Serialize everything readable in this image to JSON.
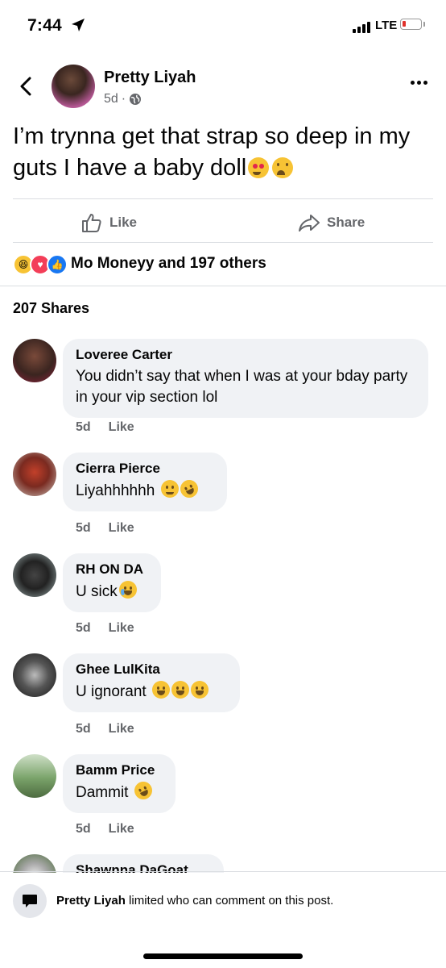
{
  "status_bar": {
    "time": "7:44",
    "network": "LTE"
  },
  "post": {
    "author": "Pretty Liyah",
    "age": "5d",
    "separator": "·",
    "text": "I’m trynna get that strap so deep in my guts I have a baby doll",
    "actions": {
      "like": "Like",
      "share": "Share"
    },
    "reactions_text": "Mo Moneyy and 197 others",
    "shares_text": "207 Shares"
  },
  "comments": [
    {
      "name": "Loveree Carter",
      "text": "You didn’t say that when I was at your bday party in your vip section lol",
      "age": "5d",
      "like": "Like"
    },
    {
      "name": "Cierra Pierce",
      "text": "Liyahhhhhh",
      "age": "5d",
      "like": "Like"
    },
    {
      "name": "RH ON DA",
      "text": "U sick",
      "age": "5d",
      "like": "Like"
    },
    {
      "name": "Ghee LulKita",
      "text": "U ignorant",
      "age": "5d",
      "like": "Like"
    },
    {
      "name": "Bamm Price",
      "text": "Dammit",
      "age": "5d",
      "like": "Like"
    },
    {
      "name": "Shawnna DaGoat"
    }
  ],
  "footer": {
    "name": "Pretty Liyah",
    "message": "limited who can comment on this post."
  },
  "colors": {
    "accent": "#1877f2",
    "secondary_text": "#65676b",
    "bubble": "#f0f2f5",
    "battery_low": "#e0312b"
  },
  "icons": [
    "location-arrow-icon",
    "signal-icon",
    "battery-icon",
    "back-chevron-icon",
    "globe-icon",
    "more-dots-icon",
    "thumbs-up-icon",
    "share-arrow-icon",
    "haha-reaction-icon",
    "love-reaction-icon",
    "like-reaction-icon",
    "comment-bubble-icon"
  ]
}
